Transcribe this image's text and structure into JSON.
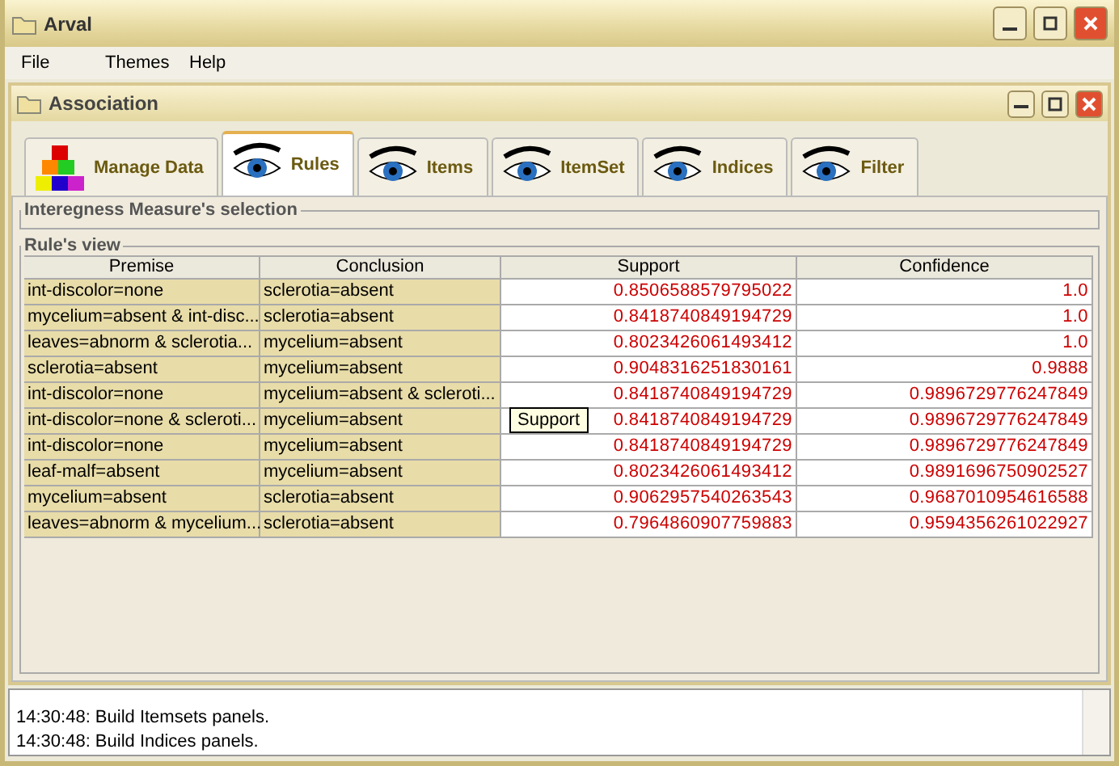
{
  "window": {
    "title": "Arval"
  },
  "menu": [
    "File",
    "Themes",
    "Help"
  ],
  "internal_frame": {
    "title": "Association"
  },
  "tabs": [
    {
      "label": "Manage Data",
      "kind": "blocks",
      "selected": false
    },
    {
      "label": "Rules",
      "kind": "eye",
      "selected": true
    },
    {
      "label": "Items",
      "kind": "eye",
      "selected": false
    },
    {
      "label": "ItemSet",
      "kind": "eye",
      "selected": false
    },
    {
      "label": "Indices",
      "kind": "eye",
      "selected": false
    },
    {
      "label": "Filter",
      "kind": "eye",
      "selected": false
    }
  ],
  "measure_panel": {
    "title": "Interegness Measure's selection"
  },
  "rules_panel": {
    "title": "Rule's view"
  },
  "table": {
    "columns": [
      "Premise",
      "Conclusion",
      "Support",
      "Confidence"
    ],
    "rows": [
      [
        "int-discolor=none",
        "sclerotia=absent",
        "0.8506588579795022",
        "1.0"
      ],
      [
        "mycelium=absent & int-disc...",
        "sclerotia=absent",
        "0.8418740849194729",
        "1.0"
      ],
      [
        "leaves=abnorm & sclerotia...",
        "mycelium=absent",
        "0.8023426061493412",
        "1.0"
      ],
      [
        "sclerotia=absent",
        "mycelium=absent",
        "0.9048316251830161",
        "0.9888"
      ],
      [
        "int-discolor=none",
        "mycelium=absent & scleroti...",
        "0.8418740849194729",
        "0.9896729776247849"
      ],
      [
        "int-discolor=none & scleroti...",
        "mycelium=absent",
        "0.8418740849194729",
        "0.9896729776247849"
      ],
      [
        "int-discolor=none",
        "mycelium=absent",
        "0.8418740849194729",
        "0.9896729776247849"
      ],
      [
        "leaf-malf=absent",
        "mycelium=absent",
        "0.8023426061493412",
        "0.9891696750902527"
      ],
      [
        "mycelium=absent",
        "sclerotia=absent",
        "0.9062957540263543",
        "0.9687010954616588"
      ],
      [
        "leaves=abnorm & mycelium...",
        "sclerotia=absent",
        "0.7964860907759883",
        "0.9594356261022927"
      ]
    ],
    "tooltip": "Support"
  },
  "log": [
    "14:30:48: Build Itemsets panels.",
    "14:30:48: Build Indices panels."
  ]
}
